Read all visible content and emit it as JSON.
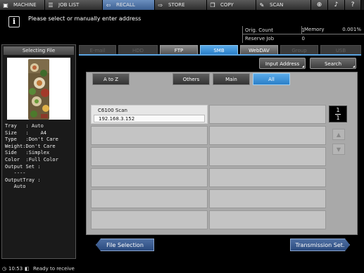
{
  "nav": {
    "machine": "MACHINE",
    "joblist": "JOB LIST",
    "recall": "RECALL",
    "store": "STORE",
    "copy": "COPY",
    "scan": "SCAN"
  },
  "message": {
    "text": "Please select or manually enter address"
  },
  "counter": {
    "orig_count_label": "Orig. Count",
    "orig_count_value": "1",
    "memory_label": "Memory",
    "memory_value": "0.001%",
    "reserve_job_label": "Reserve Job",
    "reserve_job_value": "0"
  },
  "left_panel": {
    "title": "Selecting File",
    "props": "Tray   : Auto\nSize   :    A4\nType   :Don't Care\nWeight:Don't Care\nSide   :Simplex\nColor  :Full Color\nOutput Set :\n   ----\nOutputTray :\n   Auto"
  },
  "tabs": {
    "email": "E-mail",
    "hdd": "HDD",
    "ftp": "FTP",
    "smb": "SMB",
    "webdav": "WebDAV",
    "group": "Group",
    "usb": "USB"
  },
  "buttons": {
    "input_address": "Input Address",
    "search": "Search",
    "a_to_z": "A to Z",
    "others": "Others",
    "main": "Main",
    "all": "All",
    "file_selection": "File Selection",
    "transmission_set": "Transmission Set."
  },
  "address_list": [
    {
      "name": "C6100 Scan",
      "address": "192.168.3.152"
    }
  ],
  "page": {
    "current": "1",
    "total": "1"
  },
  "status": {
    "time": "10:53",
    "text": "Ready to receive"
  },
  "colors": {
    "accent_blue": "#2a7fc8",
    "nav_active": "#3c5f91",
    "bottom_button": "#2a4a7e"
  }
}
